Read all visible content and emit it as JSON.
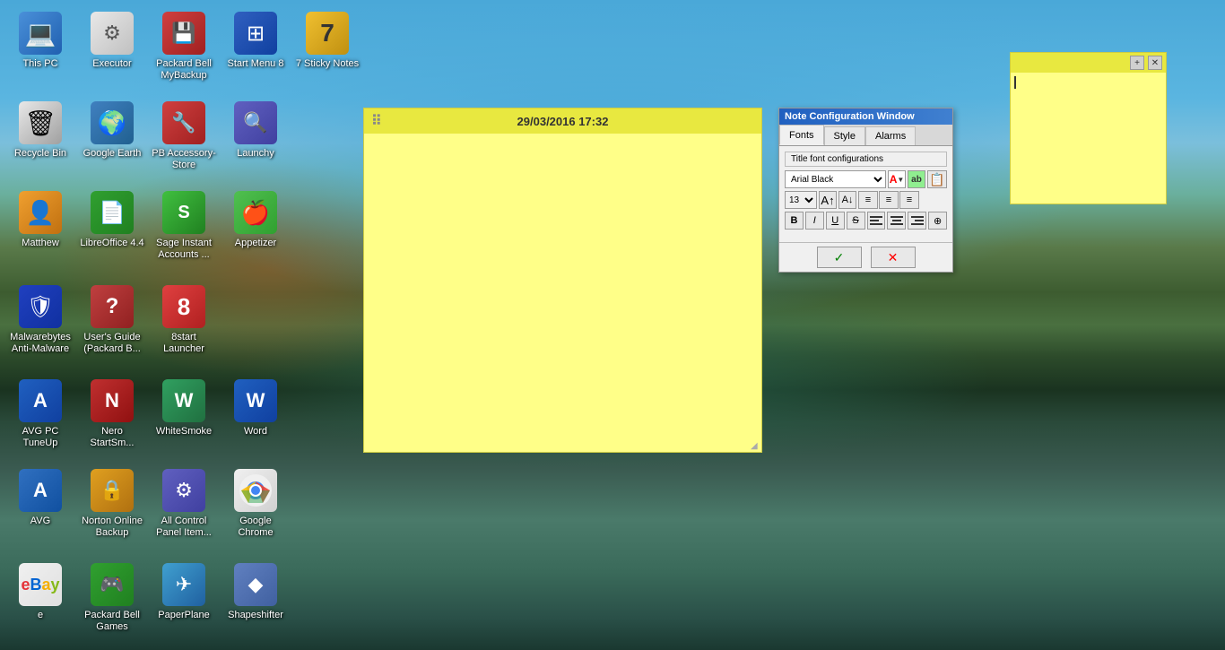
{
  "desktop": {
    "icons": [
      {
        "id": "this-pc",
        "label": "This PC",
        "icon": "💻",
        "color": "ic-this-pc",
        "col": 1,
        "row": 1
      },
      {
        "id": "executor",
        "label": "Executor",
        "icon": "⚙",
        "color": "ic-executor",
        "col": 2,
        "row": 1
      },
      {
        "id": "pb-backup",
        "label": "Packard Bell MyBackup",
        "icon": "💾",
        "color": "ic-pb-backup",
        "col": 3,
        "row": 1
      },
      {
        "id": "start-menu",
        "label": "Start Menu 8",
        "icon": "⊞",
        "color": "ic-start-menu",
        "col": 4,
        "row": 1
      },
      {
        "id": "7sticky",
        "label": "7 Sticky Notes",
        "icon": "7",
        "color": "ic-7sticky",
        "col": 4,
        "row": 1
      },
      {
        "id": "recycle-bin",
        "label": "Recycle Bin",
        "icon": "🗑",
        "color": "ic-recycle",
        "col": 1,
        "row": 2
      },
      {
        "id": "google-earth",
        "label": "Google Earth",
        "icon": "🌍",
        "color": "ic-google-earth",
        "col": 2,
        "row": 2
      },
      {
        "id": "pb-acc-store",
        "label": "PB Accessory-Store",
        "icon": "🔧",
        "color": "ic-pb-acc",
        "col": 3,
        "row": 2
      },
      {
        "id": "launchy",
        "label": "Launchy",
        "icon": "🔍",
        "color": "ic-launchy",
        "col": 4,
        "row": 2
      },
      {
        "id": "matthew",
        "label": "Matthew",
        "icon": "👤",
        "color": "ic-matthew",
        "col": 1,
        "row": 3
      },
      {
        "id": "libreoffice",
        "label": "LibreOffice 4.4",
        "icon": "📄",
        "color": "ic-libreoffice",
        "col": 2,
        "row": 3
      },
      {
        "id": "sage",
        "label": "Sage Instant Accounts ...",
        "icon": "S",
        "color": "ic-sage",
        "col": 3,
        "row": 3
      },
      {
        "id": "appetizer",
        "label": "Appetizer",
        "icon": "🍎",
        "color": "ic-appetizer",
        "col": 4,
        "row": 3
      },
      {
        "id": "malware",
        "label": "Malwarebytes Anti-Malware",
        "icon": "🛡",
        "color": "ic-malware",
        "col": 1,
        "row": 4
      },
      {
        "id": "usersguide",
        "label": "User's Guide (Packard B...",
        "icon": "?",
        "color": "ic-usersguide",
        "col": 2,
        "row": 4
      },
      {
        "id": "8start",
        "label": "8start Launcher",
        "icon": "8",
        "color": "ic-8start",
        "col": 3,
        "row": 4
      },
      {
        "id": "avg-tune",
        "label": "AVG PC TuneUp",
        "icon": "A",
        "color": "ic-avg",
        "col": 1,
        "row": 5
      },
      {
        "id": "nero",
        "label": "Nero StartSm...",
        "icon": "N",
        "color": "ic-nero",
        "col": 2,
        "row": 5
      },
      {
        "id": "whitesmoke",
        "label": "WhiteSmoke",
        "icon": "W",
        "color": "ic-whitesmoke",
        "col": 3,
        "row": 5
      },
      {
        "id": "word",
        "label": "Word",
        "icon": "W",
        "color": "ic-word",
        "col": 4,
        "row": 5
      },
      {
        "id": "avg",
        "label": "AVG",
        "icon": "A",
        "color": "ic-avgtune",
        "col": 1,
        "row": 6
      },
      {
        "id": "norton",
        "label": "Norton Online Backup",
        "icon": "N",
        "color": "ic-norton",
        "col": 2,
        "row": 6
      },
      {
        "id": "allcontrol",
        "label": "All Control Panel Item...",
        "icon": "⚙",
        "color": "ic-allcontrol",
        "col": 3,
        "row": 6
      },
      {
        "id": "chrome",
        "label": "Google Chrome",
        "icon": "C",
        "color": "ic-chrome",
        "col": 4,
        "row": 6
      },
      {
        "id": "ebay",
        "label": "e",
        "icon": "e",
        "color": "ic-ebay",
        "col": 1,
        "row": 7
      },
      {
        "id": "pbgames",
        "label": "Packard Bell Games",
        "icon": "🎮",
        "color": "ic-pbgames",
        "col": 2,
        "row": 7
      },
      {
        "id": "paperplane",
        "label": "PaperPlane",
        "icon": "✈",
        "color": "ic-paperplane",
        "col": 3,
        "row": 7
      },
      {
        "id": "shapeshifter",
        "label": "Shapeshifter",
        "icon": "◆",
        "color": "ic-shapeshifter",
        "col": 4,
        "row": 7
      }
    ]
  },
  "sticky_note": {
    "datetime": "29/03/2016 17:32",
    "content": ""
  },
  "mini_sticky": {
    "add_label": "+",
    "close_label": "✕"
  },
  "note_config": {
    "title": "Note Configuration Window",
    "tabs": [
      "Fonts",
      "Style",
      "Alarms"
    ],
    "active_tab": "Fonts",
    "section_title": "Title font configurations",
    "font_name": "Arial Black",
    "font_size": "13",
    "font_color_label": "A",
    "ok_icon": "✓",
    "cancel_icon": "✕",
    "format_buttons": [
      "B",
      "I",
      "U",
      "S"
    ],
    "align_buttons": [
      "≡",
      "≡",
      "≡",
      "⊕"
    ]
  }
}
